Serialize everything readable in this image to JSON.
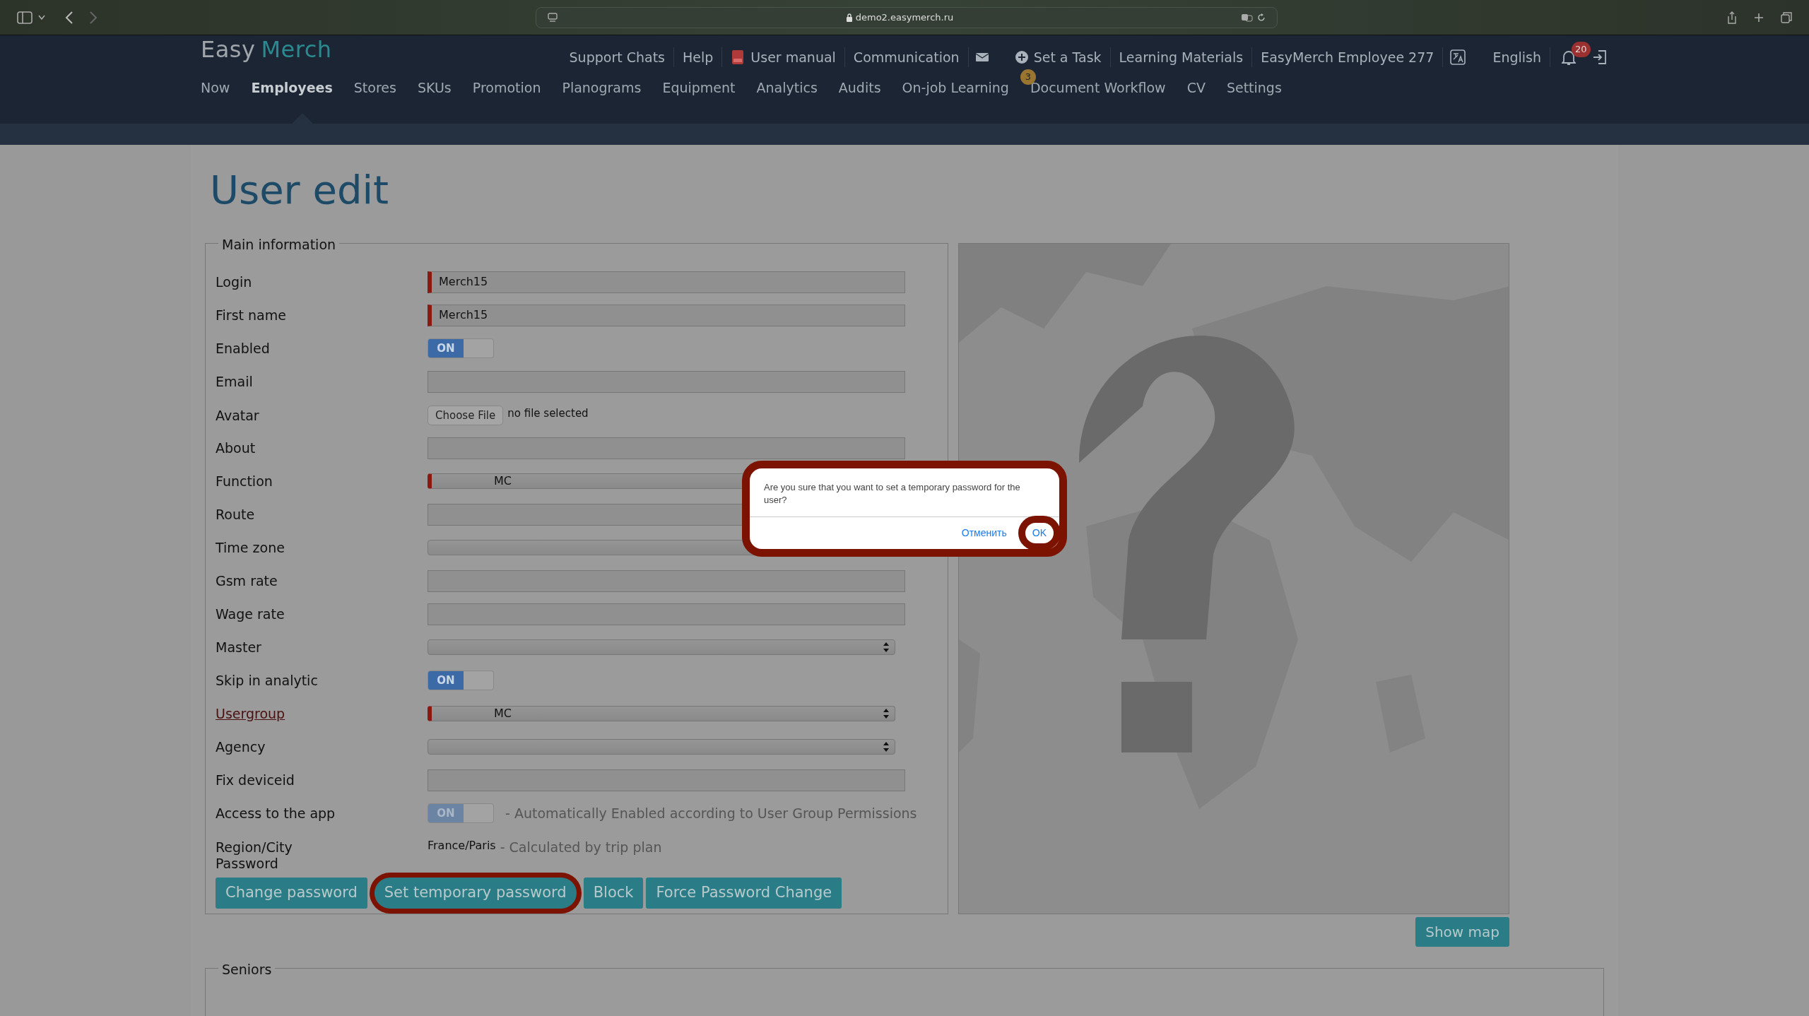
{
  "browser": {
    "url": "demo2.easymerch.ru"
  },
  "app": {
    "logo": [
      "Easy",
      "Merch"
    ],
    "top_links": [
      {
        "label": "Support Chats"
      },
      {
        "label": "Help"
      },
      {
        "label": "User manual"
      },
      {
        "label": "Communication"
      },
      {
        "label": "Set a Task"
      },
      {
        "label": "Learning Materials"
      },
      {
        "label": "EasyMerch Employee 277"
      },
      {
        "label": "English"
      }
    ],
    "notifications": "20",
    "menu": [
      {
        "label": "Now",
        "selected": false
      },
      {
        "label": "Employees",
        "selected": true
      },
      {
        "label": "Stores",
        "selected": false
      },
      {
        "label": "SKUs",
        "selected": false
      },
      {
        "label": "Promotion",
        "selected": false
      },
      {
        "label": "Planograms",
        "selected": false
      },
      {
        "label": "Equipment",
        "selected": false
      },
      {
        "label": "Analytics",
        "selected": false
      },
      {
        "label": "Audits",
        "selected": false
      },
      {
        "label": "On-job Learning",
        "selected": false
      },
      {
        "label": "Document Workflow",
        "selected": false,
        "badge": "3"
      },
      {
        "label": "CV",
        "selected": false
      },
      {
        "label": "Settings",
        "selected": false
      }
    ]
  },
  "page_title": "User edit",
  "main_information": {
    "legend": "Main information",
    "fields": [
      {
        "label": "Login",
        "kind": "text",
        "required": true,
        "value": "Merch15"
      },
      {
        "label": "First name",
        "kind": "text",
        "required": true,
        "value": "Merch15"
      },
      {
        "label": "Enabled",
        "kind": "toggle",
        "on": true,
        "disabled": false,
        "state_label": "ON"
      },
      {
        "label": "Email",
        "kind": "text",
        "required": false
      },
      {
        "label": "Avatar",
        "kind": "file",
        "button": "Choose File",
        "note": "no file selected"
      },
      {
        "label": "About",
        "kind": "text",
        "required": false
      },
      {
        "label": "Function",
        "kind": "select",
        "required": true,
        "value": "MC"
      },
      {
        "label": "Route",
        "kind": "text",
        "required": false
      },
      {
        "label": "Time zone",
        "kind": "select",
        "required": false
      },
      {
        "label": "Gsm rate",
        "kind": "text",
        "required": false
      },
      {
        "label": "Wage rate",
        "kind": "text",
        "required": false
      },
      {
        "label": "Master",
        "kind": "select",
        "required": false
      },
      {
        "label": "Skip in analytic",
        "kind": "toggle",
        "on": true,
        "disabled": false,
        "state_label": "ON"
      },
      {
        "label": "Usergroup",
        "kind": "select",
        "required": true,
        "value": "MC",
        "link": true
      },
      {
        "label": "Agency",
        "kind": "select",
        "required": false
      },
      {
        "label": "Fix deviceid",
        "kind": "text",
        "required": false
      },
      {
        "label": "Access to the app",
        "kind": "toggle",
        "on": true,
        "disabled": true,
        "state_label": "ON",
        "note": "- Automatically Enabled according to User Group Permissions"
      },
      {
        "label": "Region/City",
        "kind": "static",
        "value": "France/Paris",
        "note": "- Calculated by trip plan"
      }
    ],
    "password_label": "Password",
    "buttons": [
      {
        "label": "Change password",
        "highlighted": false
      },
      {
        "label": "Set temporary password",
        "highlighted": true
      },
      {
        "label": "Block",
        "highlighted": false
      },
      {
        "label": "Force Password Change",
        "highlighted": false
      }
    ]
  },
  "map": {
    "kind": "picture",
    "button": "Show map"
  },
  "seniors": {
    "legend": "Seniors"
  },
  "dialog": {
    "message": "Are you sure that you want to set a temporary password for the user?",
    "buttons": [
      {
        "label": "Отменить",
        "highlighted": false
      },
      {
        "label": "OK",
        "highlighted": true
      }
    ]
  }
}
